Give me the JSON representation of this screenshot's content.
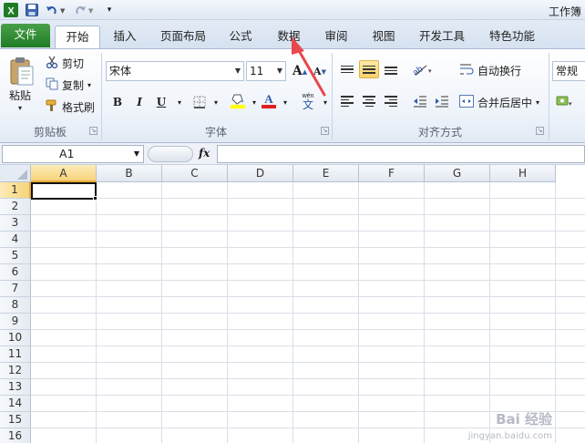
{
  "app": {
    "title": "工作簿"
  },
  "qat": {
    "icons": [
      "excel-logo-icon",
      "save-icon",
      "undo-icon",
      "redo-icon",
      "customize-qat-icon"
    ]
  },
  "tabs": [
    "文件",
    "开始",
    "插入",
    "页面布局",
    "公式",
    "数据",
    "审阅",
    "视图",
    "开发工具",
    "特色功能"
  ],
  "active_tab": "开始",
  "ribbon": {
    "clipboard": {
      "paste": "粘贴",
      "cut": "剪切",
      "copy": "复制",
      "format_painter": "格式刷",
      "label": "剪贴板"
    },
    "font": {
      "font_name": "宋体",
      "font_size": "11",
      "bold": "B",
      "italic": "I",
      "underline": "U",
      "grow": "A",
      "shrink": "A",
      "label": "字体"
    },
    "alignment": {
      "wrap_text": "自动换行",
      "merge_center": "合并后居中",
      "label": "对齐方式"
    },
    "number": {
      "format": "常规"
    }
  },
  "formula_bar": {
    "name_box": "A1",
    "fx": "fx",
    "value": ""
  },
  "sheet": {
    "columns": [
      "A",
      "B",
      "C",
      "D",
      "E",
      "F",
      "G",
      "H"
    ],
    "rows": [
      "1",
      "2",
      "3",
      "4",
      "5",
      "6",
      "7",
      "8",
      "9",
      "10",
      "11",
      "12",
      "13",
      "14",
      "15",
      "16"
    ],
    "active_cell": "A1"
  },
  "colors": {
    "file_tab": "#2a8a2e",
    "highlight": "#fbd36a",
    "arrow": "#e8474c",
    "font_color": "#e02020",
    "fill_color": "#ffff00"
  },
  "watermark": {
    "line1": "Bai 经验",
    "line2": "jingyan.baidu.com"
  }
}
